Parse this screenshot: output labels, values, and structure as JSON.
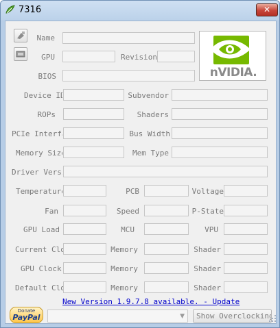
{
  "window": {
    "title": "7316",
    "close_glyph": "✕"
  },
  "logo": {
    "text": "nVIDIA."
  },
  "labels": {
    "name": "Name",
    "gpu": "GPU",
    "revision": "Revision",
    "bios": "BIOS",
    "device_id": "Device ID",
    "subvendor": "Subvendor",
    "rops": "ROPs",
    "shaders": "Shaders",
    "pcie_interface": "PCIe Interface",
    "bus_width": "Bus Width",
    "memory_size": "Memory Size",
    "mem_type": "Mem Type",
    "driver_version": "Driver Version",
    "temperature": "Temperature",
    "pcb": "PCB",
    "voltage": "Voltage",
    "fan": "Fan",
    "speed": "Speed",
    "p_state": "P-State",
    "gpu_load": "GPU Load",
    "mcu": "MCU",
    "vpu": "VPU",
    "current_clock": "Current Clock",
    "memory_1": "Memory",
    "shader_1": "Shader",
    "gpu_clock": "GPU Clock",
    "memory_2": "Memory",
    "shader_2": "Shader",
    "default_clock": "Default Clock",
    "memory_3": "Memory",
    "shader_3": "Shader"
  },
  "update_link": "New Version 1.9.7.8 available. - Update",
  "paypal": {
    "top": "Donate",
    "bottom": "PayPal"
  },
  "gpu_select": {
    "value": ""
  },
  "overclock_button": "Show Overclocking",
  "icons": {
    "app": "green-leaf-icon",
    "side_top": "screenshot-icon",
    "side_bottom": "card-icon",
    "select_arrow": "▼"
  }
}
